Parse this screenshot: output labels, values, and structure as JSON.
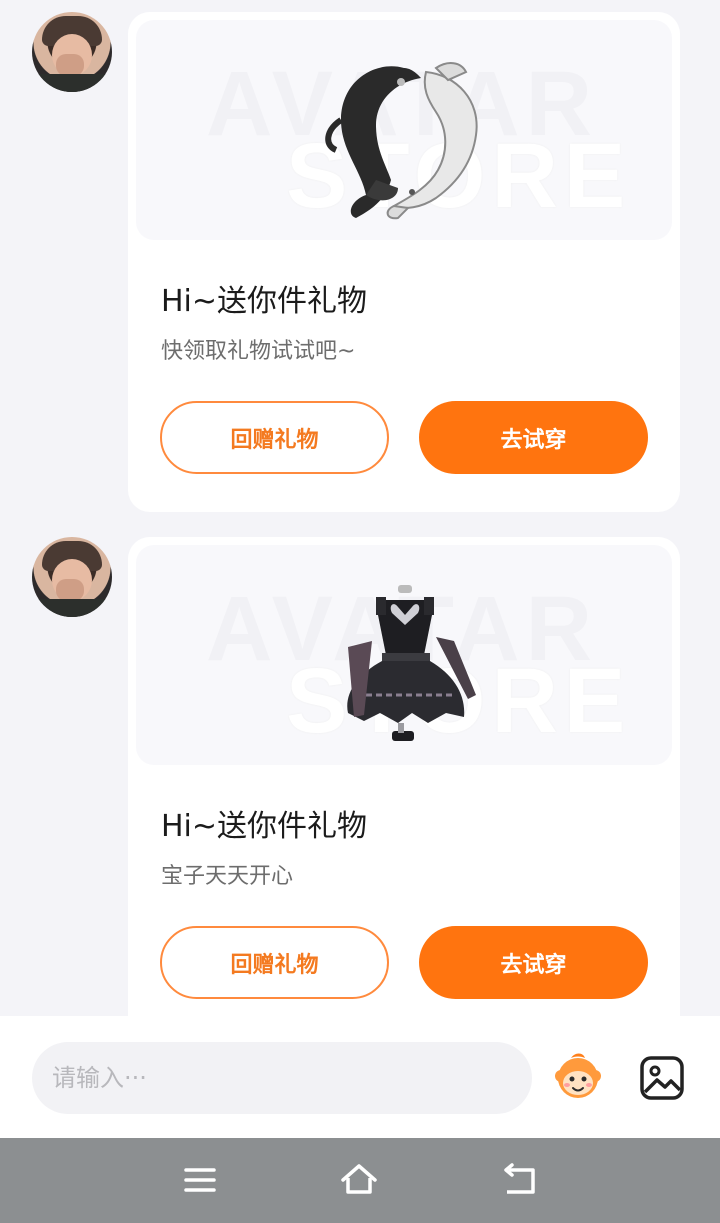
{
  "messages": [
    {
      "card": {
        "watermark_top": "AVATAR",
        "watermark_bottom": "STORE",
        "title": "Hi~送你件礼物",
        "message": "快领取礼物试试吧~",
        "return_label": "回赠礼物",
        "try_label": "去试穿",
        "item_icon": "yin-yang-koi-fish"
      }
    },
    {
      "card": {
        "watermark_top": "AVATAR",
        "watermark_bottom": "STORE",
        "title": "Hi~送你件礼物",
        "message": "宝子天天开心",
        "return_label": "回赠礼物",
        "try_label": "去试穿",
        "item_icon": "gothic-dress-outfit"
      }
    }
  ],
  "input_bar": {
    "placeholder": "请输入···",
    "emoji_icon": "monkey-face-icon",
    "image_icon": "image-icon"
  },
  "nav_bar": {
    "menu_icon": "menu-icon",
    "home_icon": "home-icon",
    "back_icon": "back-icon"
  },
  "colors": {
    "accent": "#ff740f",
    "accent_border": "#ff8a3d",
    "background": "#f4f4f8",
    "nav_bar": "#8c8f91"
  }
}
